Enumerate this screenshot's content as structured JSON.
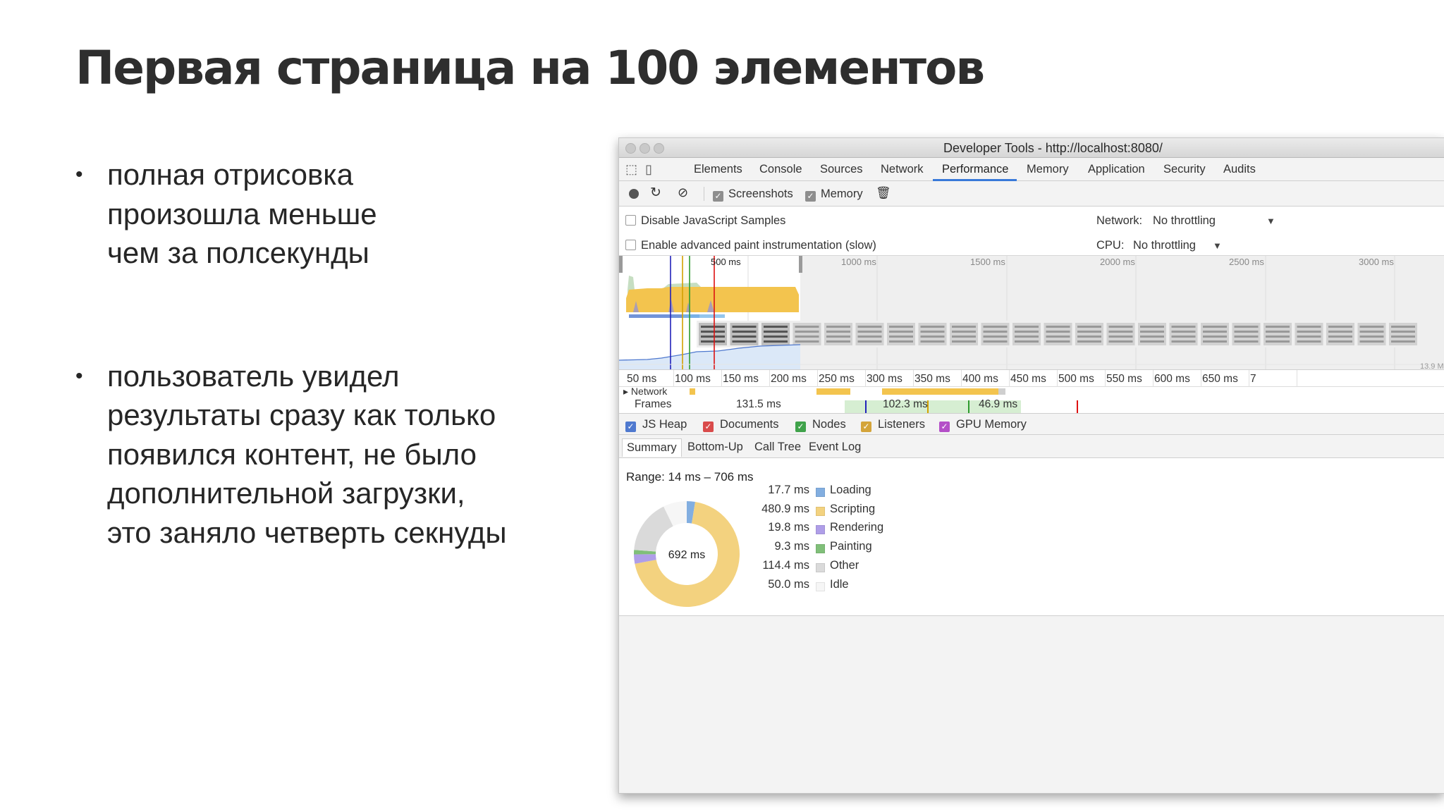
{
  "slide": {
    "title": "Первая страница на 100 элементов",
    "bullets": [
      {
        "lines": [
          "полная отрисовка",
          "произошла меньше",
          "чем за полсекунды"
        ]
      },
      {
        "lines": [
          "пользователь увидел",
          "результаты сразу как только",
          "появился контент, не было",
          "дополнительной загрузки,",
          "это заняло четверть секнуды"
        ]
      }
    ],
    "bullet_mark": "•"
  },
  "window": {
    "title": "Developer Tools - http://localhost:8080/",
    "tabs": [
      "Elements",
      "Console",
      "Sources",
      "Network",
      "Performance",
      "Memory",
      "Application",
      "Security",
      "Audits"
    ],
    "active_tab": "Performance",
    "toolbar": {
      "screenshots_label": "Screenshots",
      "screenshots_checked": true,
      "memory_label": "Memory",
      "memory_checked": true
    },
    "settings": {
      "disable_js_samples": "Disable JavaScript Samples",
      "advanced_paint": "Enable advanced paint instrumentation (slow)",
      "network_label": "Network:",
      "network_value": "No throttling",
      "cpu_label": "CPU:",
      "cpu_value": "No throttling"
    },
    "overview": {
      "ticks": [
        "500 ms",
        "1000 ms",
        "1500 ms",
        "2000 ms",
        "2500 ms",
        "3000 ms"
      ],
      "heap_label": "13.9 M"
    },
    "ruler": {
      "ticks": [
        "50 ms",
        "100 ms",
        "150 ms",
        "200 ms",
        "250 ms",
        "300 ms",
        "350 ms",
        "400 ms",
        "450 ms",
        "500 ms",
        "550 ms",
        "600 ms",
        "650 ms",
        "7"
      ]
    },
    "tracks": {
      "network_label": "Network",
      "frames_label": "Frames",
      "frame_times": [
        "131.5 ms",
        "102.3 ms",
        "46.9 ms"
      ]
    },
    "counters": [
      {
        "label": "JS Heap",
        "color": "#4f79cf"
      },
      {
        "label": "Documents",
        "color": "#d94b4b"
      },
      {
        "label": "Nodes",
        "color": "#3fa24a"
      },
      {
        "label": "Listeners",
        "color": "#d4a43a"
      },
      {
        "label": "GPU Memory",
        "color": "#b44fc8"
      }
    ],
    "subtabs": [
      "Summary",
      "Bottom-Up",
      "Call Tree",
      "Event Log"
    ],
    "active_subtab": "Summary",
    "summary": {
      "range": "Range: 14 ms – 706 ms",
      "total": "692 ms",
      "items": [
        {
          "value": "17.7 ms",
          "label": "Loading",
          "color": "#82aee0",
          "ms": 17.7
        },
        {
          "value": "480.9 ms",
          "label": "Scripting",
          "color": "#f3d27f",
          "ms": 480.9
        },
        {
          "value": "19.8 ms",
          "label": "Rendering",
          "color": "#af9ee8",
          "ms": 19.8
        },
        {
          "value": "9.3 ms",
          "label": "Painting",
          "color": "#80bf79",
          "ms": 9.3
        },
        {
          "value": "114.4 ms",
          "label": "Other",
          "color": "#dadada",
          "ms": 114.4
        },
        {
          "value": "50.0 ms",
          "label": "Idle",
          "color": "#f6f6f6",
          "ms": 50.0
        }
      ]
    }
  }
}
